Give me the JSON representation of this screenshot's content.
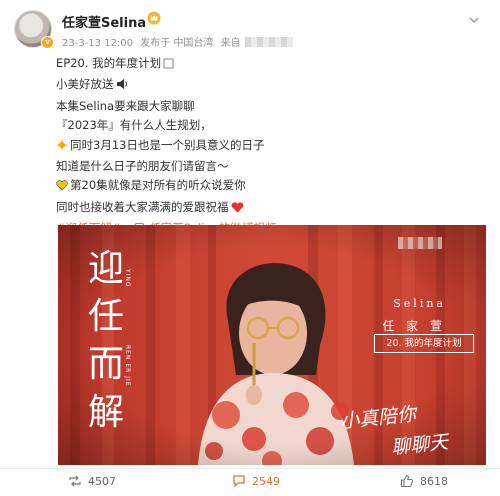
{
  "post": {
    "author": "任家萱Selina",
    "verified_badge": "v",
    "date": "23-3-13 12:00",
    "published_from": "发布于 中国台湾",
    "source_prefix": "来自"
  },
  "content": {
    "title": "EP20. 我的年度计划",
    "line2": "小美好放送",
    "line3": "本集Selina要来跟大家聊聊",
    "line4": "『2023年』有什么人生规划，",
    "line5": "同时3月13日也是一个别具意义的日子",
    "line6": "知道是什么日子的朋友们请留言～",
    "line7": "第20集就像是对所有的听众说爱你",
    "line8": "同时也接收着大家满满的爱跟祝福",
    "hashtag": "#迎任而解#",
    "video_link": "任家萱Selina的微博视频"
  },
  "media": {
    "title_chars": [
      "迎",
      "任",
      "而",
      "解"
    ],
    "small_text_top": "YING",
    "small_text_bottom": "REN ER JIE",
    "brand_en": "Selina",
    "brand_zh": "任 家 萱",
    "episode": "20. 我的年度计划",
    "handwriting_1": "小真陪你",
    "handwriting_2": "聊聊天"
  },
  "actions": {
    "reposts": "4507",
    "comments": "2549",
    "likes": "8618"
  },
  "colors": {
    "accent": "#eb7340",
    "curtain": "#c9442f",
    "badge": "#f2a91d"
  },
  "icons": [
    "crown-icon",
    "chevron-down-icon",
    "speaker-icon",
    "sparkle-icon",
    "heart-icon",
    "video-link-icon",
    "repost-icon",
    "comment-icon",
    "like-icon"
  ]
}
